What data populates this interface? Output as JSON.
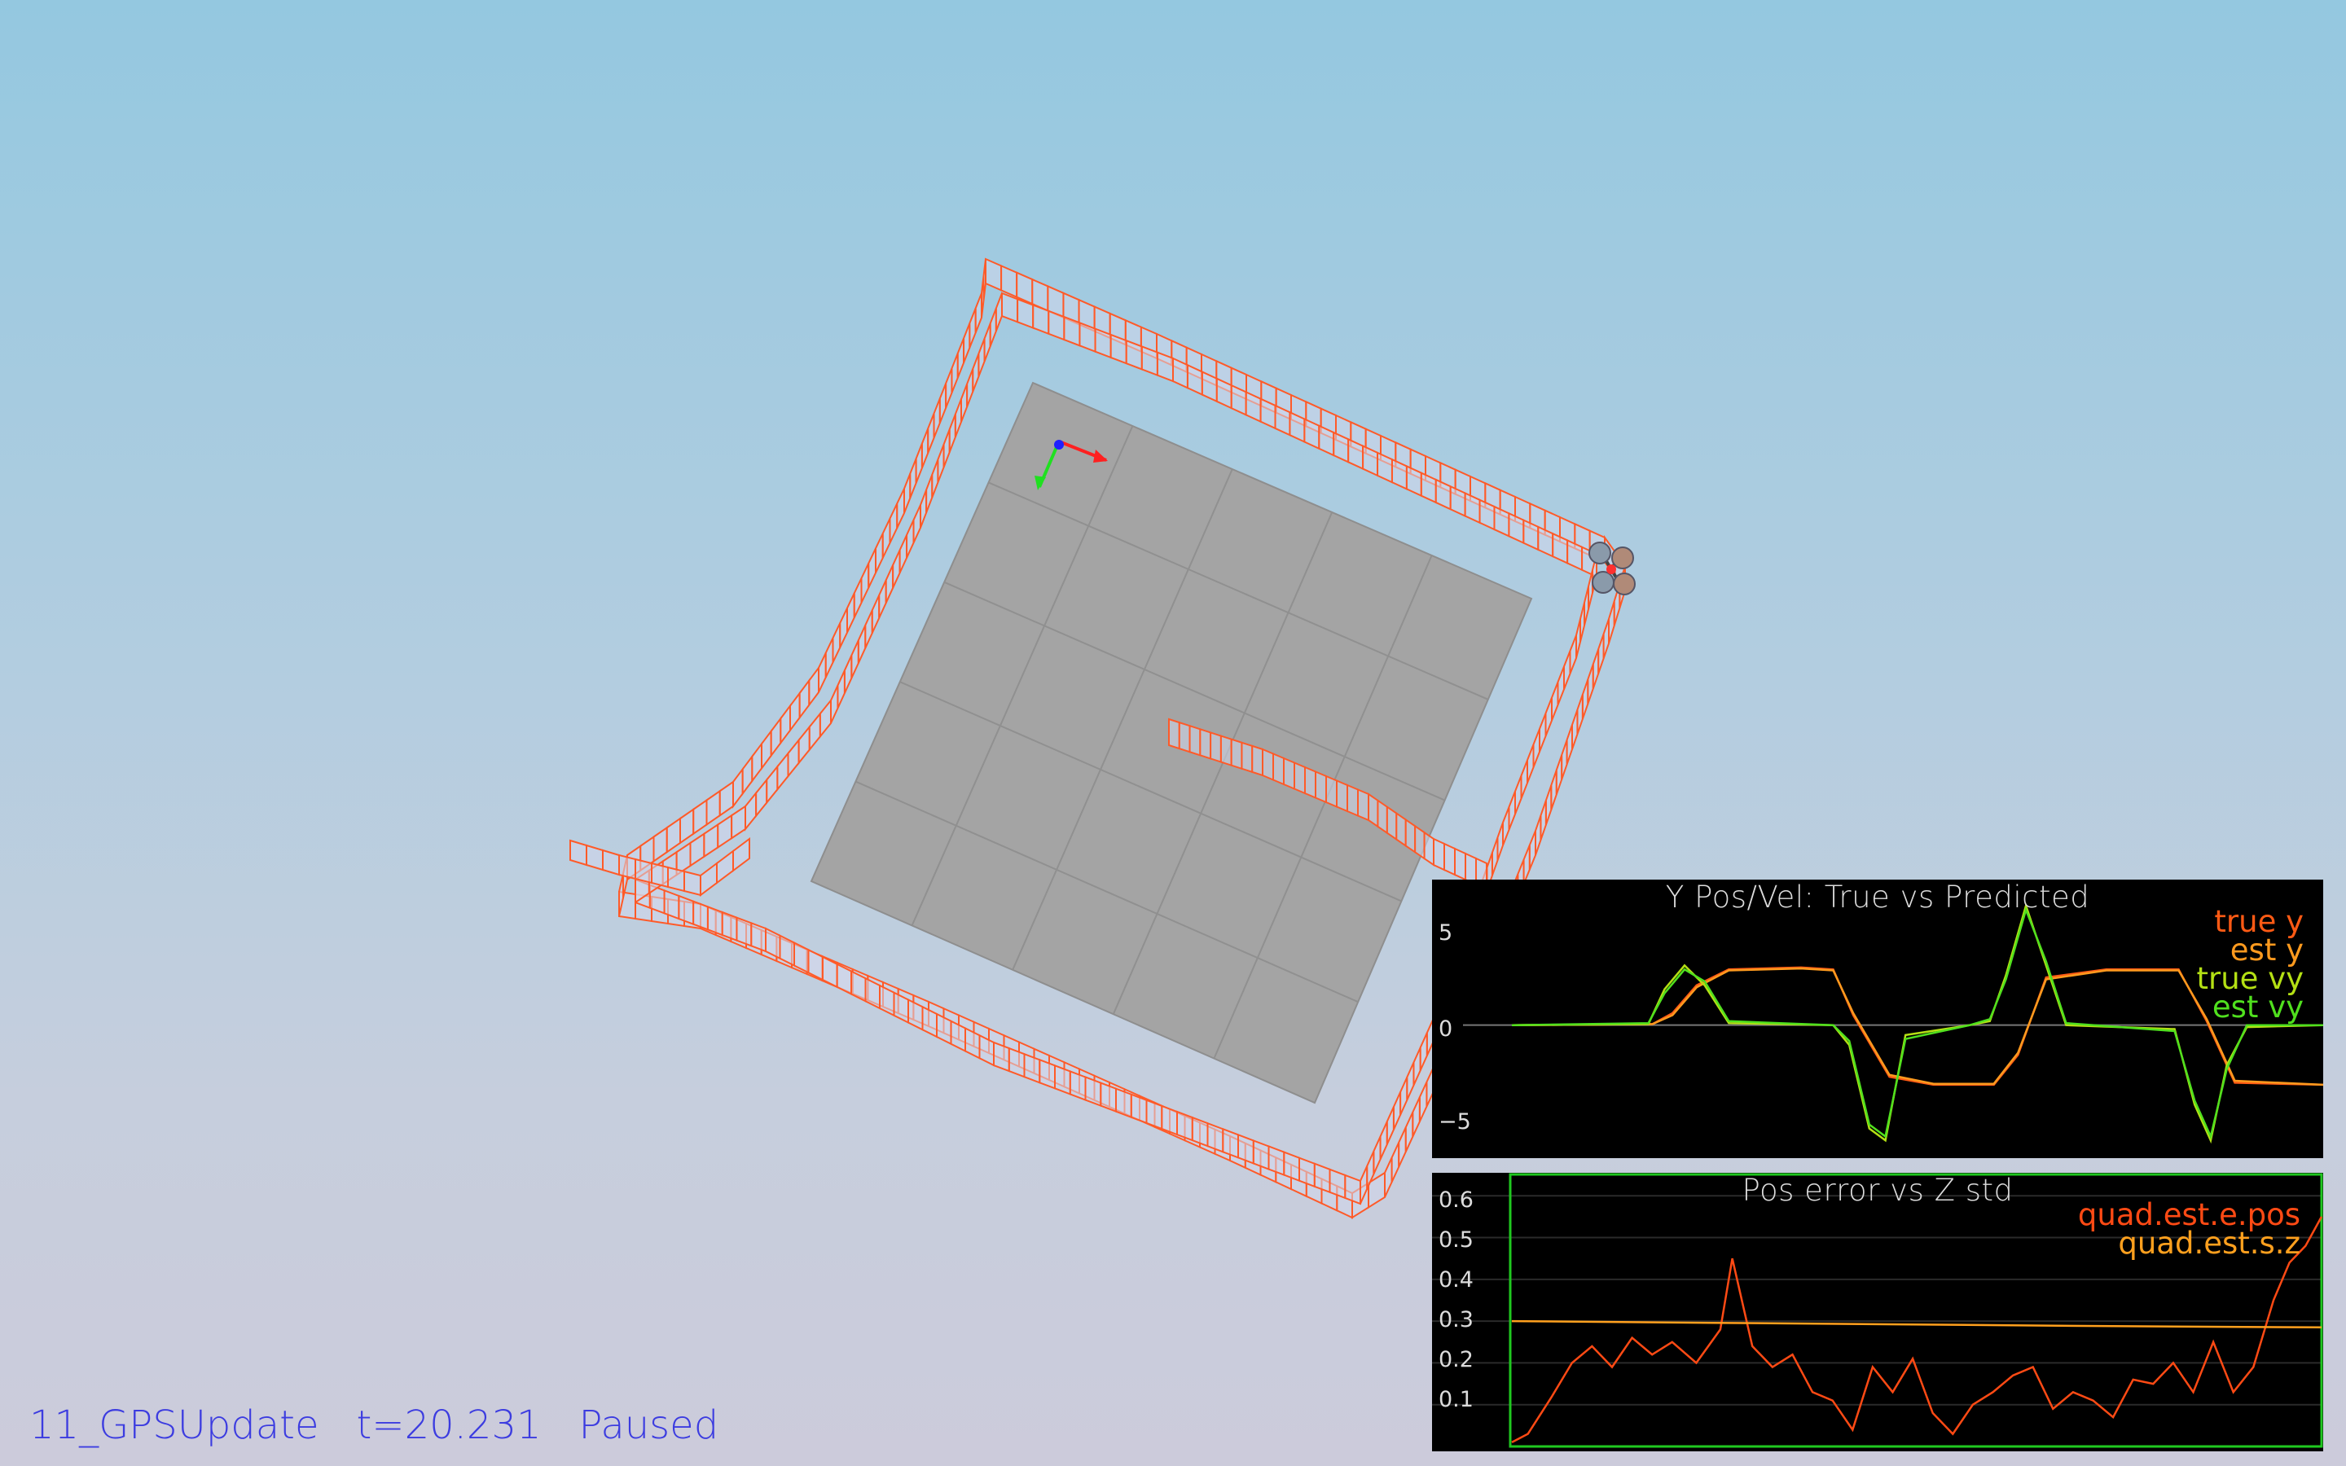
{
  "status_bar": {
    "scenario": "11_GPSUpdate",
    "time": "t=20.231",
    "state": "Paused"
  },
  "colors": {
    "background_top": "#94c8e0",
    "background_bottom": "#cccbdb",
    "trajectory": "#ff5a28",
    "ground": "#a4a4a4",
    "status_text": "#3c3ce0"
  },
  "plots": [
    {
      "title": "Y Pos/Vel: True vs Predicted",
      "legend": [
        {
          "label": "true y",
          "color": "#ff5a14"
        },
        {
          "label": "est y",
          "color": "#ff9a1e"
        },
        {
          "label": "true vy",
          "color": "#b4e014"
        },
        {
          "label": "est vy",
          "color": "#50e01e"
        }
      ],
      "y_ticks": [
        "5",
        "0",
        "−5"
      ]
    },
    {
      "title": "Pos error vs Z std",
      "legend": [
        {
          "label": "quad.est.e.pos",
          "color": "#ff4a14"
        },
        {
          "label": "quad.est.s.z",
          "color": "#ffa01e"
        }
      ],
      "y_ticks": [
        "0.6",
        "0.5",
        "0.4",
        "0.3",
        "0.2",
        "0.1"
      ]
    }
  ],
  "chart_data": [
    {
      "type": "line",
      "title": "Y Pos/Vel: True vs Predicted",
      "xlabel": "",
      "ylabel": "",
      "ylim": [
        -6.2,
        6.5
      ],
      "xlim": [
        0,
        20.2
      ],
      "series": [
        {
          "name": "true y",
          "x": [
            0,
            3.5,
            4.0,
            4.6,
            5.4,
            7.2,
            8.0,
            8.5,
            9.4,
            10.5,
            12.0,
            12.6,
            13.3,
            14.8,
            16.6,
            17.3,
            18.0,
            20.2
          ],
          "y": [
            0,
            0.05,
            0.6,
            2.0,
            2.8,
            2.9,
            2.8,
            0.5,
            -2.6,
            -3.0,
            -3.0,
            -1.5,
            2.4,
            2.8,
            2.8,
            0.2,
            -2.9,
            -3.0
          ]
        },
        {
          "name": "est y",
          "x": [
            0,
            3.5,
            4.0,
            4.6,
            5.4,
            7.2,
            8.0,
            8.5,
            9.4,
            10.5,
            12.0,
            12.6,
            13.3,
            14.8,
            16.6,
            17.3,
            18.0,
            20.2
          ],
          "y": [
            0,
            0.05,
            0.5,
            1.9,
            2.75,
            2.85,
            2.75,
            0.6,
            -2.5,
            -2.95,
            -2.95,
            -1.4,
            2.3,
            2.75,
            2.75,
            0.3,
            -2.8,
            -3.0
          ]
        },
        {
          "name": "true vy",
          "x": [
            0,
            3.4,
            3.8,
            4.3,
            4.8,
            5.4,
            8.0,
            8.4,
            8.9,
            9.3,
            9.8,
            11.4,
            11.9,
            12.3,
            12.8,
            13.3,
            13.8,
            16.5,
            17.0,
            17.4,
            17.8,
            18.3,
            20.2
          ],
          "y": [
            0,
            0.05,
            1.8,
            3.0,
            2.0,
            0.1,
            0,
            -1.0,
            -5.2,
            -5.8,
            -0.5,
            0,
            0.2,
            2.5,
            6.0,
            3.0,
            0,
            -0.2,
            -4.0,
            -5.8,
            -2.0,
            -0.1,
            0
          ]
        },
        {
          "name": "est vy",
          "x": [
            0,
            3.4,
            3.8,
            4.3,
            4.8,
            5.4,
            8.0,
            8.4,
            8.9,
            9.3,
            9.8,
            11.4,
            11.9,
            12.3,
            12.8,
            13.3,
            13.8,
            16.5,
            17.0,
            17.4,
            17.8,
            18.3,
            20.2
          ],
          "y": [
            0,
            0.1,
            1.6,
            2.8,
            2.2,
            0.2,
            0,
            -0.8,
            -5.0,
            -5.6,
            -0.7,
            0,
            0.3,
            2.3,
            5.8,
            3.2,
            0.1,
            -0.3,
            -3.8,
            -5.6,
            -2.2,
            0,
            0
          ]
        }
      ]
    },
    {
      "type": "line",
      "title": "Pos error vs Z std",
      "xlabel": "",
      "ylabel": "",
      "ylim": [
        0,
        0.62
      ],
      "xlim": [
        0,
        20.2
      ],
      "series": [
        {
          "name": "quad.est.e.pos",
          "x": [
            0,
            0.4,
            1.0,
            1.5,
            2.0,
            2.5,
            3.0,
            3.5,
            4.0,
            4.6,
            5.2,
            5.5,
            6.0,
            6.5,
            7.0,
            7.5,
            8.0,
            8.5,
            9.0,
            9.5,
            10.0,
            10.5,
            11.0,
            11.5,
            12.0,
            12.5,
            13.0,
            13.5,
            14.0,
            14.5,
            15.0,
            15.5,
            16.0,
            16.5,
            17.0,
            17.5,
            18.0,
            18.5,
            19.0,
            19.4,
            19.8,
            20.2
          ],
          "y": [
            0.01,
            0.03,
            0.12,
            0.2,
            0.24,
            0.19,
            0.26,
            0.22,
            0.25,
            0.2,
            0.28,
            0.45,
            0.24,
            0.19,
            0.22,
            0.13,
            0.11,
            0.04,
            0.19,
            0.13,
            0.21,
            0.08,
            0.03,
            0.1,
            0.13,
            0.17,
            0.19,
            0.09,
            0.13,
            0.11,
            0.07,
            0.16,
            0.15,
            0.2,
            0.13,
            0.25,
            0.13,
            0.19,
            0.35,
            0.44,
            0.48,
            0.55
          ]
        },
        {
          "name": "quad.est.s.z",
          "x": [
            0,
            5,
            10,
            15,
            20.2
          ],
          "y": [
            0.3,
            0.296,
            0.292,
            0.288,
            0.285
          ]
        }
      ]
    }
  ]
}
